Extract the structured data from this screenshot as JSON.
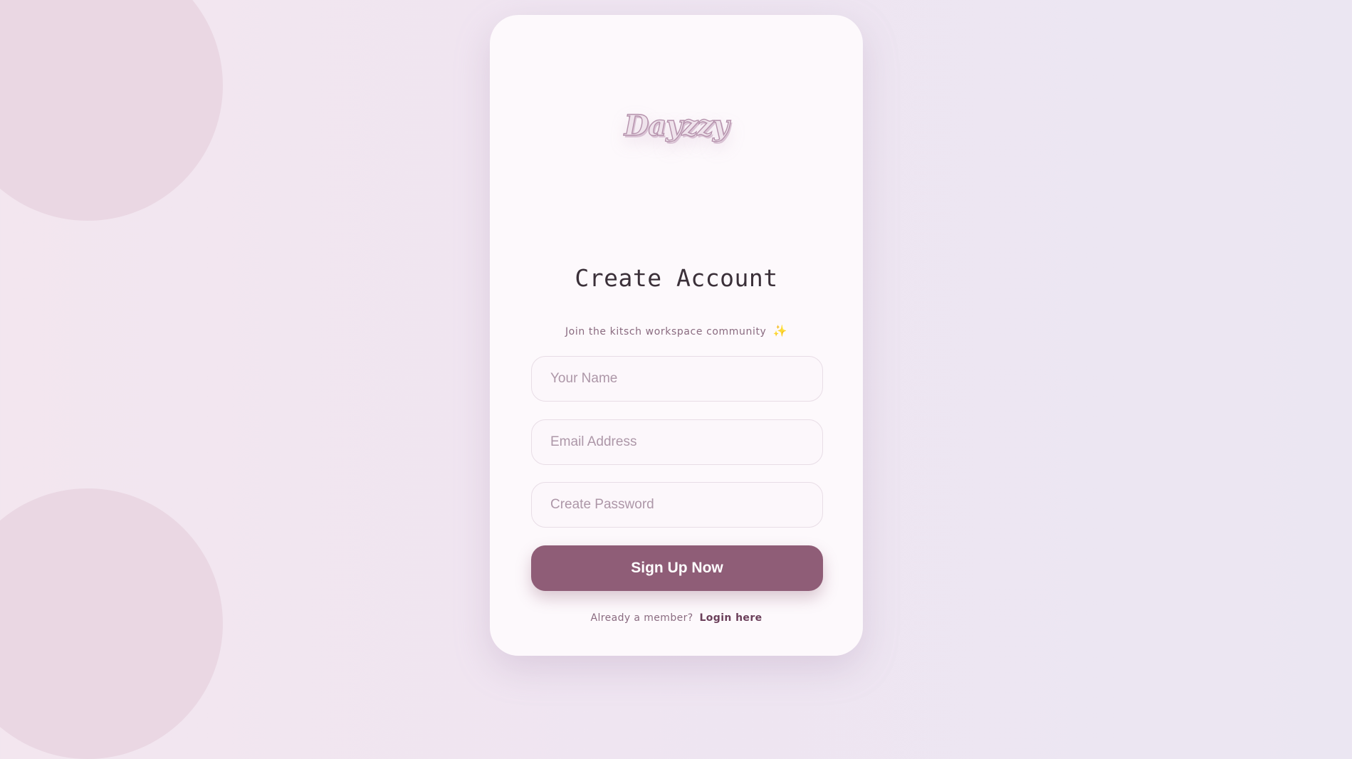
{
  "brand": {
    "logo_text": "Dayzzy"
  },
  "form": {
    "title": "Create Account",
    "subtitle": "Join the kitsch workspace community",
    "subtitle_icon": "✨",
    "fields": {
      "name": {
        "placeholder": "Your Name",
        "value": ""
      },
      "email": {
        "placeholder": "Email Address",
        "value": ""
      },
      "password": {
        "placeholder": "Create Password",
        "value": ""
      }
    },
    "submit_label": "Sign Up Now"
  },
  "footer": {
    "prompt": "Already a member?",
    "login_link": "Login here"
  },
  "colors": {
    "accent": "#8f5d77",
    "card": "#fdf9fc",
    "background": "#f3e6ef",
    "circle": "#e9d6e1"
  },
  "icons": {
    "subtitle_icon_name": "sparkle-icon"
  }
}
